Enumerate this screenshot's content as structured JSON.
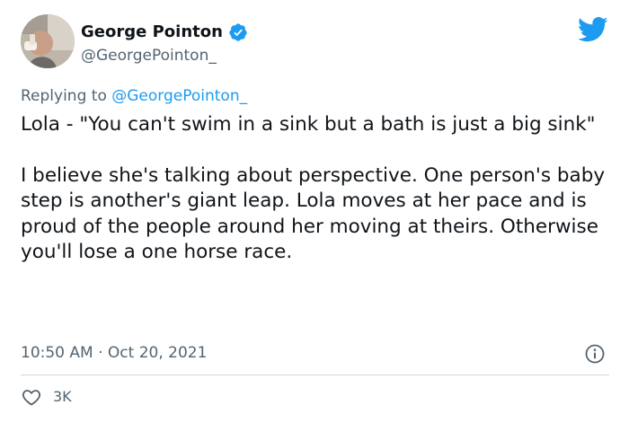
{
  "author": {
    "display_name": "George Pointon",
    "handle": "@GeorgePointon_",
    "avatar_icon": "profile-photo",
    "verified_icon": "verified-badge-icon"
  },
  "reply": {
    "prefix": "Replying to ",
    "mention": "@GeorgePointon_"
  },
  "tweet": {
    "paragraphs": [
      "Lola - \"You can't swim in a sink but a bath is just a big sink\"",
      "I believe she's talking about perspective. One person's baby step is another's giant leap. Lola moves at her pace and is proud of the people around her moving at theirs. Otherwise you'll lose a one horse race."
    ]
  },
  "meta": {
    "time": "10:50 AM",
    "separator": " · ",
    "date": "Oct 20, 2021"
  },
  "actions": {
    "like_count": "3K"
  },
  "colors": {
    "brand": "#1d9bf0",
    "text": "#0f1419",
    "secondary": "#536471",
    "divider": "#cfd9de"
  }
}
